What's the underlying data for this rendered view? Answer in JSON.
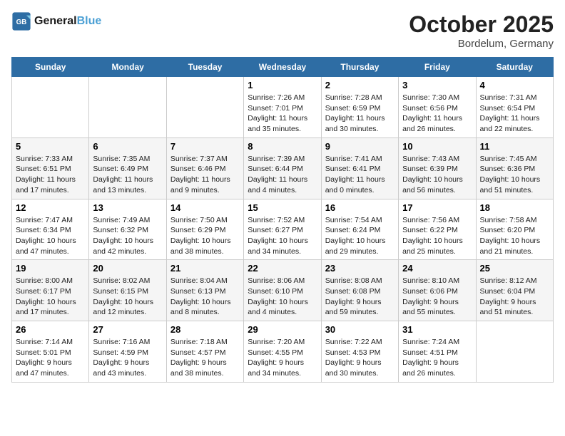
{
  "header": {
    "logo_line1": "General",
    "logo_line2": "Blue",
    "month": "October 2025",
    "location": "Bordelum, Germany"
  },
  "days_of_week": [
    "Sunday",
    "Monday",
    "Tuesday",
    "Wednesday",
    "Thursday",
    "Friday",
    "Saturday"
  ],
  "weeks": [
    [
      {
        "date": "",
        "content": ""
      },
      {
        "date": "",
        "content": ""
      },
      {
        "date": "",
        "content": ""
      },
      {
        "date": "1",
        "content": "Sunrise: 7:26 AM\nSunset: 7:01 PM\nDaylight: 11 hours and 35 minutes."
      },
      {
        "date": "2",
        "content": "Sunrise: 7:28 AM\nSunset: 6:59 PM\nDaylight: 11 hours and 30 minutes."
      },
      {
        "date": "3",
        "content": "Sunrise: 7:30 AM\nSunset: 6:56 PM\nDaylight: 11 hours and 26 minutes."
      },
      {
        "date": "4",
        "content": "Sunrise: 7:31 AM\nSunset: 6:54 PM\nDaylight: 11 hours and 22 minutes."
      }
    ],
    [
      {
        "date": "5",
        "content": "Sunrise: 7:33 AM\nSunset: 6:51 PM\nDaylight: 11 hours and 17 minutes."
      },
      {
        "date": "6",
        "content": "Sunrise: 7:35 AM\nSunset: 6:49 PM\nDaylight: 11 hours and 13 minutes."
      },
      {
        "date": "7",
        "content": "Sunrise: 7:37 AM\nSunset: 6:46 PM\nDaylight: 11 hours and 9 minutes."
      },
      {
        "date": "8",
        "content": "Sunrise: 7:39 AM\nSunset: 6:44 PM\nDaylight: 11 hours and 4 minutes."
      },
      {
        "date": "9",
        "content": "Sunrise: 7:41 AM\nSunset: 6:41 PM\nDaylight: 11 hours and 0 minutes."
      },
      {
        "date": "10",
        "content": "Sunrise: 7:43 AM\nSunset: 6:39 PM\nDaylight: 10 hours and 56 minutes."
      },
      {
        "date": "11",
        "content": "Sunrise: 7:45 AM\nSunset: 6:36 PM\nDaylight: 10 hours and 51 minutes."
      }
    ],
    [
      {
        "date": "12",
        "content": "Sunrise: 7:47 AM\nSunset: 6:34 PM\nDaylight: 10 hours and 47 minutes."
      },
      {
        "date": "13",
        "content": "Sunrise: 7:49 AM\nSunset: 6:32 PM\nDaylight: 10 hours and 42 minutes."
      },
      {
        "date": "14",
        "content": "Sunrise: 7:50 AM\nSunset: 6:29 PM\nDaylight: 10 hours and 38 minutes."
      },
      {
        "date": "15",
        "content": "Sunrise: 7:52 AM\nSunset: 6:27 PM\nDaylight: 10 hours and 34 minutes."
      },
      {
        "date": "16",
        "content": "Sunrise: 7:54 AM\nSunset: 6:24 PM\nDaylight: 10 hours and 29 minutes."
      },
      {
        "date": "17",
        "content": "Sunrise: 7:56 AM\nSunset: 6:22 PM\nDaylight: 10 hours and 25 minutes."
      },
      {
        "date": "18",
        "content": "Sunrise: 7:58 AM\nSunset: 6:20 PM\nDaylight: 10 hours and 21 minutes."
      }
    ],
    [
      {
        "date": "19",
        "content": "Sunrise: 8:00 AM\nSunset: 6:17 PM\nDaylight: 10 hours and 17 minutes."
      },
      {
        "date": "20",
        "content": "Sunrise: 8:02 AM\nSunset: 6:15 PM\nDaylight: 10 hours and 12 minutes."
      },
      {
        "date": "21",
        "content": "Sunrise: 8:04 AM\nSunset: 6:13 PM\nDaylight: 10 hours and 8 minutes."
      },
      {
        "date": "22",
        "content": "Sunrise: 8:06 AM\nSunset: 6:10 PM\nDaylight: 10 hours and 4 minutes."
      },
      {
        "date": "23",
        "content": "Sunrise: 8:08 AM\nSunset: 6:08 PM\nDaylight: 9 hours and 59 minutes."
      },
      {
        "date": "24",
        "content": "Sunrise: 8:10 AM\nSunset: 6:06 PM\nDaylight: 9 hours and 55 minutes."
      },
      {
        "date": "25",
        "content": "Sunrise: 8:12 AM\nSunset: 6:04 PM\nDaylight: 9 hours and 51 minutes."
      }
    ],
    [
      {
        "date": "26",
        "content": "Sunrise: 7:14 AM\nSunset: 5:01 PM\nDaylight: 9 hours and 47 minutes."
      },
      {
        "date": "27",
        "content": "Sunrise: 7:16 AM\nSunset: 4:59 PM\nDaylight: 9 hours and 43 minutes."
      },
      {
        "date": "28",
        "content": "Sunrise: 7:18 AM\nSunset: 4:57 PM\nDaylight: 9 hours and 38 minutes."
      },
      {
        "date": "29",
        "content": "Sunrise: 7:20 AM\nSunset: 4:55 PM\nDaylight: 9 hours and 34 minutes."
      },
      {
        "date": "30",
        "content": "Sunrise: 7:22 AM\nSunset: 4:53 PM\nDaylight: 9 hours and 30 minutes."
      },
      {
        "date": "31",
        "content": "Sunrise: 7:24 AM\nSunset: 4:51 PM\nDaylight: 9 hours and 26 minutes."
      },
      {
        "date": "",
        "content": ""
      }
    ]
  ]
}
